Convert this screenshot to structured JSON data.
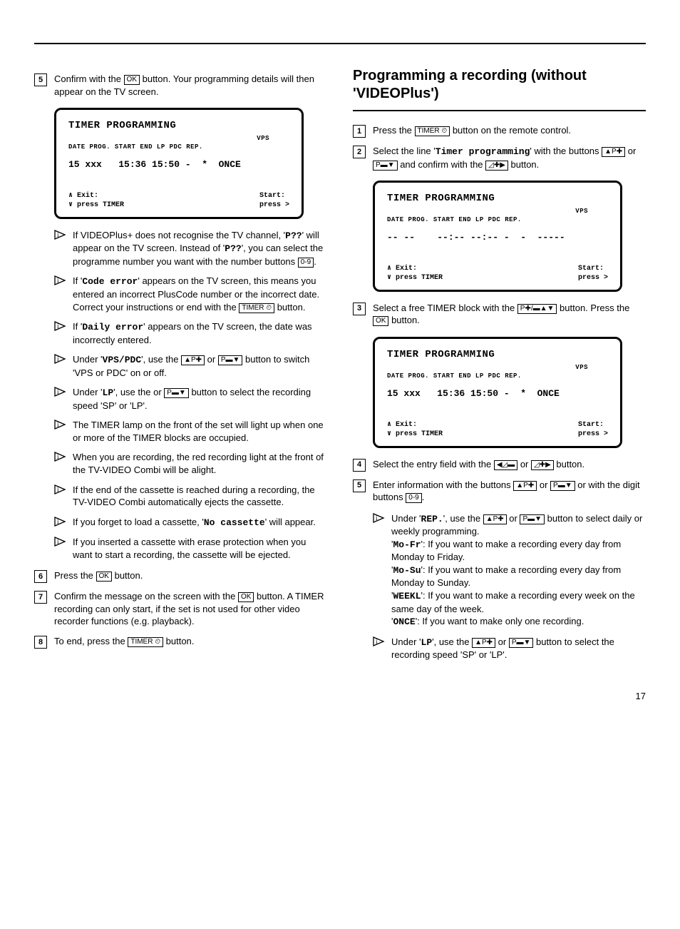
{
  "page_number": "17",
  "buttons": {
    "ok": "OK",
    "digits": "0-9",
    "timer": "TIMER ⏲"
  },
  "tv_common": {
    "title": "TIMER PROGRAMMING",
    "vps_label": "VPS",
    "headers": "DATE PROG. START  END  LP PDC REP.",
    "footer_left": "∧ Exit:\n∨ press TIMER",
    "footer_right": "Start:\npress >"
  },
  "left": {
    "step5": {
      "text_a": "Confirm with the ",
      "text_b": " button. Your programming details will then appear on the TV screen."
    },
    "tv1_row": "15 xxx   15:36 15:50 -  *  ONCE",
    "notes": {
      "n1a": "If VIDEOPlus+ does not recognise the TV channel, '",
      "n1code": "P??",
      "n1b": "' will appear on the TV screen. Instead of '",
      "n1c": "', you can select the programme number you want with the number buttons ",
      "n2a": "If '",
      "n2code": "Code error",
      "n2b": "' appears on the TV screen, this means you entered an incorrect PlusCode number or the incorrect date. Correct your instructions or end with the ",
      "n2c": " button.",
      "n3a": "If '",
      "n3code": "Daily error",
      "n3b": "' appears on the TV screen, the date was incorrectly entered.",
      "n4a": "Under '",
      "n4code": "VPS/PDC",
      "n4b": "', use the ",
      "n4c": " or ",
      "n4d": " button to switch 'VPS or PDC' on or off.",
      "n5a": "Under '",
      "n5code": "LP",
      "n5b": "', use the or ",
      "n5c": " button to select the recording speed 'SP' or 'LP'.",
      "n6": "The TIMER lamp on the front of the set will light up when one or more of the TIMER blocks are occupied.",
      "n7": "When you are recording, the red recording light at the front of the TV-VIDEO Combi will be alight.",
      "n8": "If the end of the cassette is reached during a recording, the TV-VIDEO Combi automatically ejects the cassette.",
      "n9a": "If you forget to load a cassette, '",
      "n9code": "No cassette",
      "n9b": "' will appear.",
      "n10": "If you inserted a cassette with erase protection when you want to start a recording, the cassette will be ejected."
    },
    "step6": {
      "a": "Press the ",
      "b": " button."
    },
    "step7": {
      "a": "Confirm the message on the screen with the ",
      "b": " button. A TIMER recording can only start, if the set is not used for other video recorder functions (e.g. playback)."
    },
    "step8": {
      "a": "To end, press the ",
      "b": " button."
    }
  },
  "right": {
    "heading": "Programming a recording (without 'VIDEOPlus')",
    "step1": {
      "a": "Press the ",
      "b": " button on the remote control."
    },
    "step2": {
      "a": "Select the line '",
      "code": "Timer programming",
      "b": "' with the buttons ",
      "c": " or ",
      "d": " and confirm with the ",
      "e": " button."
    },
    "tv2_row": "-- --    --:-- --:-- -  -  -----",
    "step3": {
      "a": "Select a free TIMER block with the ",
      "b": " button. Press the ",
      "c": " button."
    },
    "tv3_row": "15 xxx   15:36 15:50 -  *  ONCE",
    "step4": {
      "a": "Select the entry field with the ",
      "b": " or ",
      "c": " button."
    },
    "step5": {
      "a": "Enter information with the buttons ",
      "b": " or ",
      "c": " or with the digit buttons ",
      "d": "."
    },
    "notes": {
      "r1a": "Under '",
      "r1code": "REP.",
      "r1b": "', use the ",
      "r1c": " or ",
      "r1d": " button to select daily or weekly programming.",
      "mofr_code": "Mo-Fr",
      "mofr_txt": "': If you want to make a recording every day from Monday to Friday.",
      "mosu_code": "Mo-Su",
      "mosu_txt": "': If you want to make a recording every day from Monday to Sunday.",
      "weekl_code": "WEEKL",
      "weekl_txt": "': If you want to make a recording every week on the same day of the week.",
      "once_code": "ONCE",
      "once_txt": "': If you want to make only one recording.",
      "r2a": "Under '",
      "r2code": "LP",
      "r2b": "', use the ",
      "r2c": " or ",
      "r2d": " button to select the recording speed 'SP' or 'LP'."
    }
  }
}
